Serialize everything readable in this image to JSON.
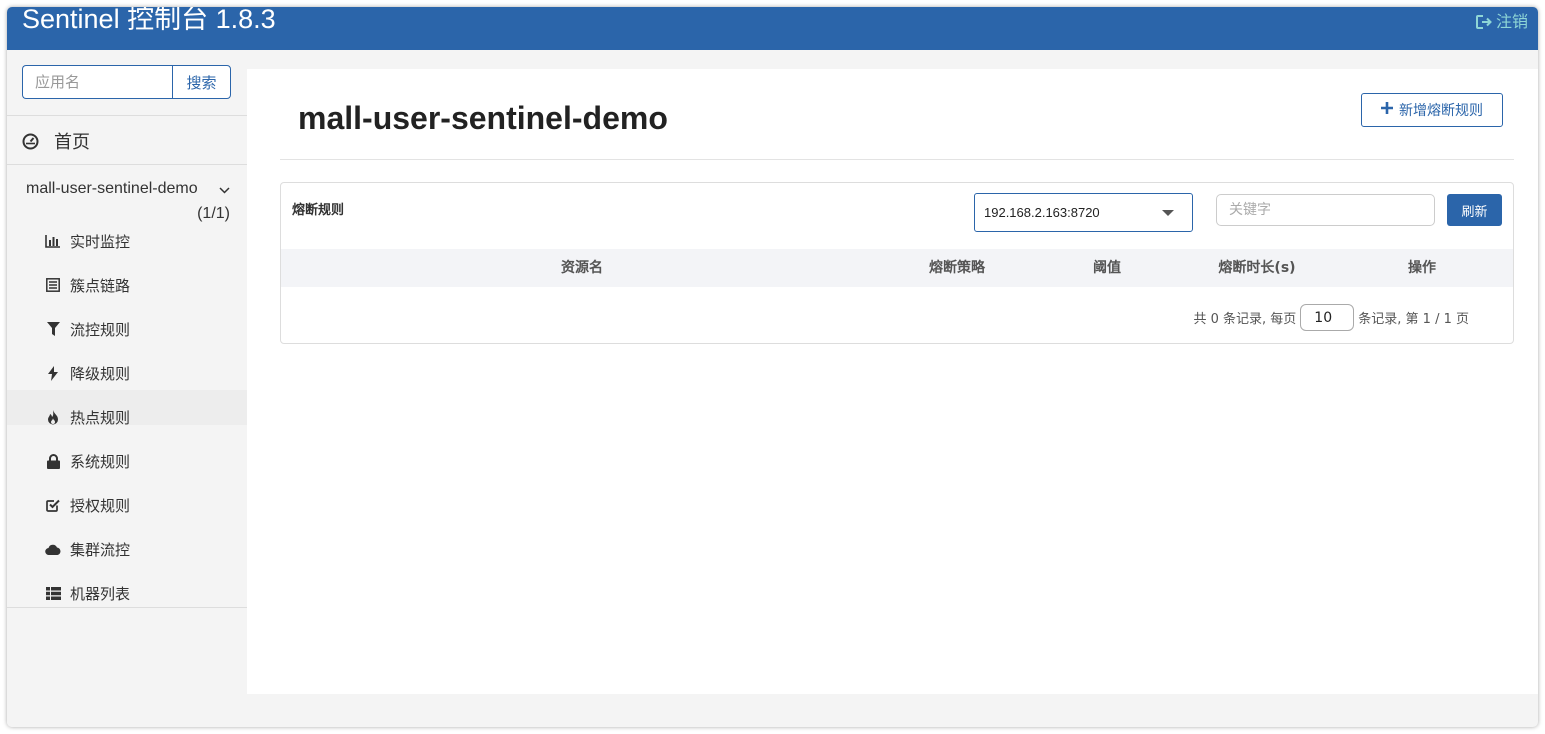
{
  "header": {
    "brand": "Sentinel 控制台 1.8.3",
    "logout_label": "注销"
  },
  "sidebar": {
    "search_placeholder": "应用名",
    "search_button": "搜索",
    "home_label": "首页",
    "app": {
      "name": "mall-user-sentinel-demo",
      "count": "(1/1)"
    },
    "items": [
      {
        "label": "实时监控",
        "icon": "bar-chart-icon"
      },
      {
        "label": "簇点链路",
        "icon": "list-alt-icon"
      },
      {
        "label": "流控规则",
        "icon": "filter-icon"
      },
      {
        "label": "降级规则",
        "icon": "flash-icon"
      },
      {
        "label": "热点规则",
        "icon": "fire-icon"
      },
      {
        "label": "系统规则",
        "icon": "lock-icon"
      },
      {
        "label": "授权规则",
        "icon": "check-icon"
      },
      {
        "label": "集群流控",
        "icon": "cloud-icon"
      },
      {
        "label": "机器列表",
        "icon": "th-list-icon"
      }
    ]
  },
  "main": {
    "title": "mall-user-sentinel-demo",
    "add_button": "新增熔断规则",
    "panel": {
      "title": "熔断规则",
      "machine_selected": "192.168.2.163:8720",
      "keyword_placeholder": "关键字",
      "refresh_button": "刷新",
      "columns": [
        "资源名",
        "熔断策略",
        "阈值",
        "熔断时长(s)",
        "操作"
      ],
      "pager": {
        "prefix": "共 0 条记录, 每页",
        "page_size": "10",
        "suffix": "条记录, 第 1 / 1 页"
      }
    }
  },
  "colors": {
    "header_bg": "#2b65aa",
    "accent": "#2b65aa",
    "logout": "#8fd6d6"
  }
}
